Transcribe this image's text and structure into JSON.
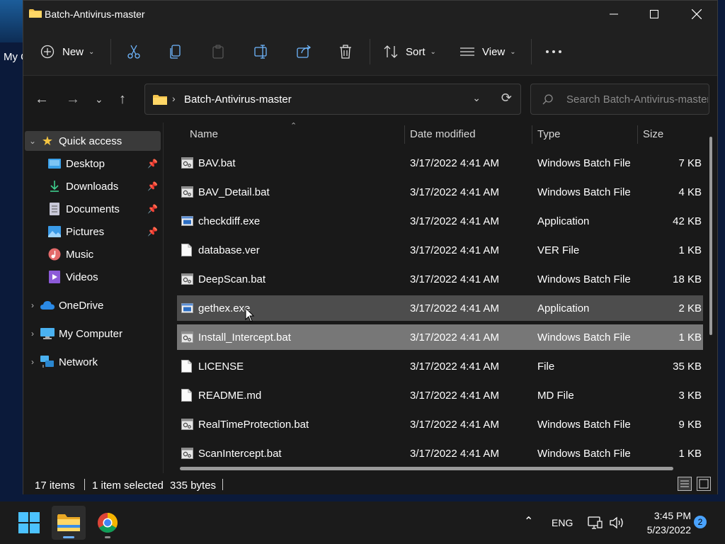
{
  "desktop": {
    "icon_label": "My C"
  },
  "window": {
    "title": "Batch-Antivirus-master"
  },
  "toolbar": {
    "new_label": "New",
    "sort_label": "Sort",
    "view_label": "View"
  },
  "address": {
    "path": "Batch-Antivirus-master",
    "search_placeholder": "Search Batch-Antivirus-master"
  },
  "nav": {
    "items": [
      {
        "label": "Quick access"
      },
      {
        "label": "Desktop"
      },
      {
        "label": "Downloads"
      },
      {
        "label": "Documents"
      },
      {
        "label": "Pictures"
      },
      {
        "label": "Music"
      },
      {
        "label": "Videos"
      },
      {
        "label": "OneDrive"
      },
      {
        "label": "My Computer"
      },
      {
        "label": "Network"
      }
    ]
  },
  "columns": {
    "name": "Name",
    "date": "Date modified",
    "type": "Type",
    "size": "Size"
  },
  "files": [
    {
      "name": "BAV.bat",
      "date": "3/17/2022 4:41 AM",
      "type": "Windows Batch File",
      "size": "7 KB"
    },
    {
      "name": "BAV_Detail.bat",
      "date": "3/17/2022 4:41 AM",
      "type": "Windows Batch File",
      "size": "4 KB"
    },
    {
      "name": "checkdiff.exe",
      "date": "3/17/2022 4:41 AM",
      "type": "Application",
      "size": "42 KB"
    },
    {
      "name": "database.ver",
      "date": "3/17/2022 4:41 AM",
      "type": "VER File",
      "size": "1 KB"
    },
    {
      "name": "DeepScan.bat",
      "date": "3/17/2022 4:41 AM",
      "type": "Windows Batch File",
      "size": "18 KB"
    },
    {
      "name": "gethex.exe",
      "date": "3/17/2022 4:41 AM",
      "type": "Application",
      "size": "2 KB"
    },
    {
      "name": "Install_Intercept.bat",
      "date": "3/17/2022 4:41 AM",
      "type": "Windows Batch File",
      "size": "1 KB"
    },
    {
      "name": "LICENSE",
      "date": "3/17/2022 4:41 AM",
      "type": "File",
      "size": "35 KB"
    },
    {
      "name": "README.md",
      "date": "3/17/2022 4:41 AM",
      "type": "MD File",
      "size": "3 KB"
    },
    {
      "name": "RealTimeProtection.bat",
      "date": "3/17/2022 4:41 AM",
      "type": "Windows Batch File",
      "size": "9 KB"
    },
    {
      "name": "ScanIntercept.bat",
      "date": "3/17/2022 4:41 AM",
      "type": "Windows Batch File",
      "size": "1 KB"
    }
  ],
  "status": {
    "count": "17 items",
    "selected": "1 item selected",
    "bytes": "335 bytes"
  },
  "taskbar": {
    "lang": "ENG",
    "time": "3:45 PM",
    "date": "5/23/2022",
    "notifications": "2"
  }
}
